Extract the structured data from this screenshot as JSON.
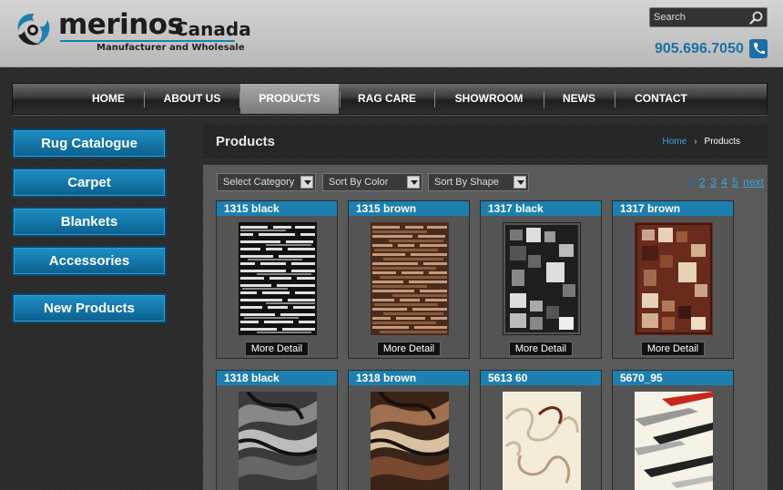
{
  "brand": {
    "name_part1": "merinos",
    "name_part2": "Canada",
    "tagline": "Manufacturer and Wholesale"
  },
  "search": {
    "placeholder": "Search"
  },
  "phone": "905.696.7050",
  "nav": {
    "items": [
      "HOME",
      "ABOUT US",
      "PRODUCTS",
      "RAG CARE",
      "SHOWROOM",
      "NEWS",
      "CONTACT"
    ],
    "active": "PRODUCTS"
  },
  "sidebar": {
    "items": [
      "Rug Catalogue",
      "Carpet",
      "Blankets",
      "Accessories",
      "New Products"
    ]
  },
  "page": {
    "title": "Products",
    "breadcrumb": {
      "home": "Home",
      "current": "Products"
    }
  },
  "filters": {
    "category": "Select Category",
    "color": "Sort By Color",
    "shape": "Sort By Shape"
  },
  "pagination": {
    "pages": [
      "1",
      "2",
      "3",
      "4",
      "5"
    ],
    "current": "1",
    "next": "next"
  },
  "products": [
    {
      "name": "1315 black",
      "button": "More Detail"
    },
    {
      "name": "1315 brown",
      "button": "More Detail"
    },
    {
      "name": "1317 black",
      "button": "More Detail"
    },
    {
      "name": "1317 brown",
      "button": "More Detail"
    },
    {
      "name": "1318 black"
    },
    {
      "name": "1318 brown"
    },
    {
      "name": "5613 60"
    },
    {
      "name": "5670_95"
    }
  ],
  "colors": {
    "accent": "#1c7fb0",
    "phone": "#1c6fa6",
    "link": "#3aa6e0"
  }
}
